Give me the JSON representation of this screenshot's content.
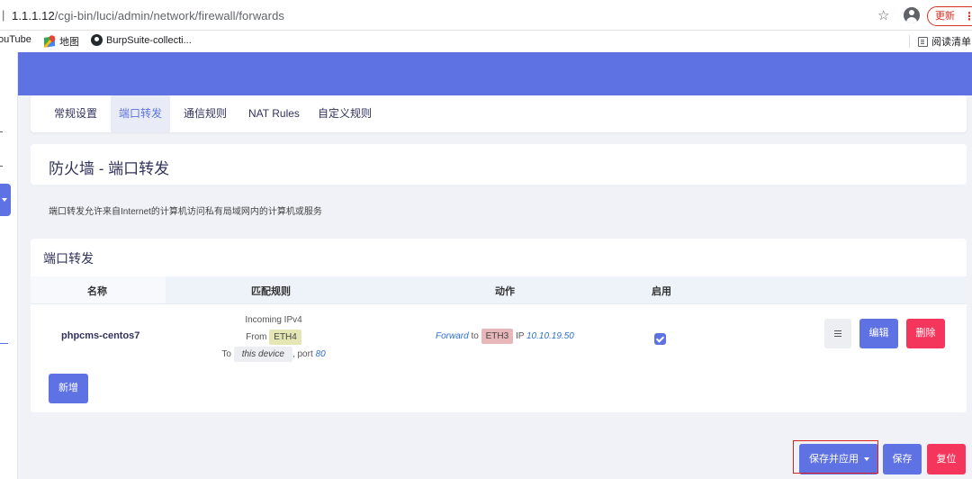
{
  "browser": {
    "url_host": "1.1.1.12",
    "url_path": "/cgi-bin/luci/admin/network/firewall/forwards",
    "update_label": "更新",
    "bookmarks": [
      {
        "label": "ouTube"
      },
      {
        "label": "地图",
        "icon": "map-icon"
      },
      {
        "label": "BurpSuite-collecti...",
        "icon": "github-icon"
      }
    ],
    "reading_list_label": "阅读清单"
  },
  "tabs": [
    {
      "label": "常规设置",
      "active": false
    },
    {
      "label": "端口转发",
      "active": true
    },
    {
      "label": "通信规则",
      "active": false
    },
    {
      "label": "NAT Rules",
      "active": false
    },
    {
      "label": "自定义规则",
      "active": false
    }
  ],
  "page": {
    "title": "防火墙 - 端口转发",
    "description": "端口转发允许来自Internet的计算机访问私有局域网内的计算机或服务"
  },
  "section": {
    "title": "端口转发",
    "columns": {
      "name": "名称",
      "match": "匹配规则",
      "action": "动作",
      "enabled": "启用"
    },
    "rows": [
      {
        "name": "phpcms-centos7",
        "match": {
          "line1": "Incoming IPv4",
          "from_label": "From",
          "from_zone": "ETH4",
          "to_label": "To",
          "to_target": "this device",
          "port_label": ", port",
          "port": "80"
        },
        "action": {
          "verb": "Forward",
          "to_label": "to",
          "zone": "ETH3",
          "ip_label": "IP",
          "ip": "10.10.19.50"
        },
        "enabled": true,
        "edit_label": "编辑",
        "delete_label": "删除"
      }
    ],
    "add_label": "新增"
  },
  "footer": {
    "save_apply_label": "保存并应用",
    "save_label": "保存",
    "reset_label": "复位"
  },
  "colors": {
    "accent": "#5e72e4",
    "danger": "#f5365c",
    "highlight": "#e02020"
  }
}
